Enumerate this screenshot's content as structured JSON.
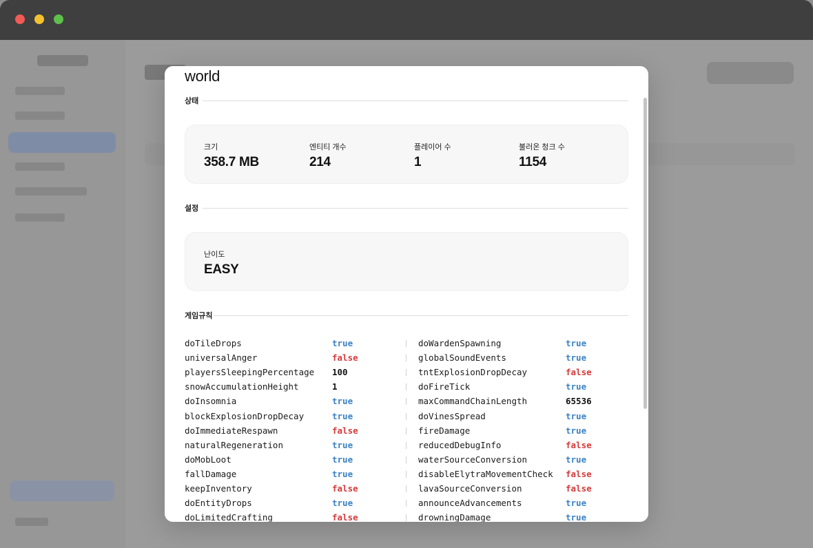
{
  "modal": {
    "title": "world",
    "status_heading": "상태",
    "status": [
      {
        "label": "크기",
        "value": "358.7 MB"
      },
      {
        "label": "엔티티 개수",
        "value": "214"
      },
      {
        "label": "플레이어 수",
        "value": "1"
      },
      {
        "label": "불러온 청크 수",
        "value": "1154"
      }
    ],
    "settings_heading": "설정",
    "settings": {
      "difficulty_label": "난이도",
      "difficulty_value": "EASY"
    },
    "gamerules_heading": "게임규칙",
    "gamerules": [
      {
        "name": "doTileDrops",
        "value": "true"
      },
      {
        "name": "doWardenSpawning",
        "value": "true"
      },
      {
        "name": "universalAnger",
        "value": "false"
      },
      {
        "name": "globalSoundEvents",
        "value": "true"
      },
      {
        "name": "playersSleepingPercentage",
        "value": "100"
      },
      {
        "name": "tntExplosionDropDecay",
        "value": "false"
      },
      {
        "name": "snowAccumulationHeight",
        "value": "1"
      },
      {
        "name": "doFireTick",
        "value": "true"
      },
      {
        "name": "doInsomnia",
        "value": "true"
      },
      {
        "name": "maxCommandChainLength",
        "value": "65536"
      },
      {
        "name": "blockExplosionDropDecay",
        "value": "true"
      },
      {
        "name": "doVinesSpread",
        "value": "true"
      },
      {
        "name": "doImmediateRespawn",
        "value": "false"
      },
      {
        "name": "fireDamage",
        "value": "true"
      },
      {
        "name": "naturalRegeneration",
        "value": "true"
      },
      {
        "name": "reducedDebugInfo",
        "value": "false"
      },
      {
        "name": "doMobLoot",
        "value": "true"
      },
      {
        "name": "waterSourceConversion",
        "value": "true"
      },
      {
        "name": "fallDamage",
        "value": "true"
      },
      {
        "name": "disableElytraMovementCheck",
        "value": "false"
      },
      {
        "name": "keepInventory",
        "value": "false"
      },
      {
        "name": "lavaSourceConversion",
        "value": "false"
      },
      {
        "name": "doEntityDrops",
        "value": "true"
      },
      {
        "name": "announceAdvancements",
        "value": "true"
      },
      {
        "name": "doLimitedCrafting",
        "value": "false"
      },
      {
        "name": "drowningDamage",
        "value": "true"
      }
    ]
  },
  "colors": {
    "true": "#3b82c4",
    "false": "#d63a3a",
    "window_close": "#f25a55",
    "window_minimize": "#f5c02f",
    "window_zoom": "#5ec04a"
  },
  "icons": [
    "window-close-icon",
    "window-minimize-icon",
    "window-zoom-icon"
  ]
}
